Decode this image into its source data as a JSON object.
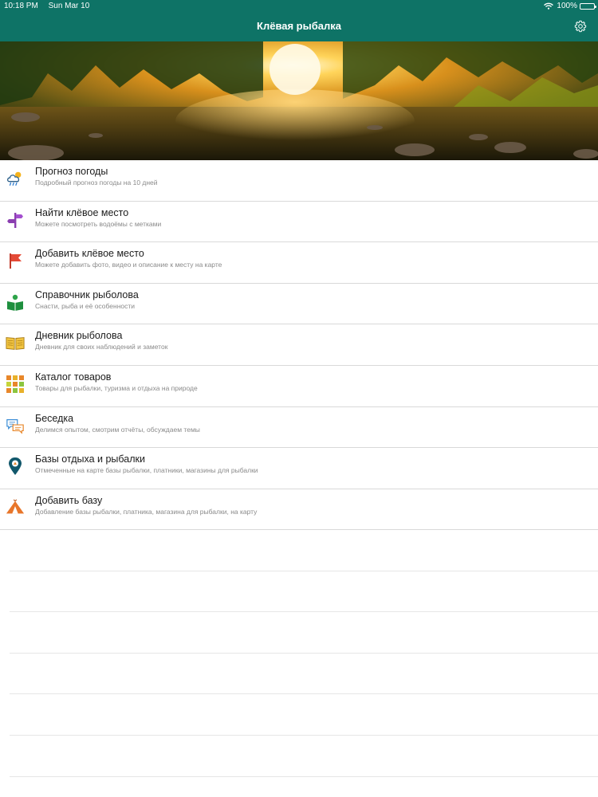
{
  "status": {
    "time": "10:18 PM",
    "date": "Sun Mar 10",
    "battery": "100%"
  },
  "header": {
    "title": "Клёвая рыбалка",
    "settings_icon": "gear-icon"
  },
  "menu": {
    "items": [
      {
        "label": "Прогноз погоды",
        "sub": "Подробный прогноз погоды на 10 дней",
        "icon": "weather-cloud-icon"
      },
      {
        "label": "Найти клёвое место",
        "sub": "Можете посмотреть водоёмы с метками",
        "icon": "signpost-icon"
      },
      {
        "label": "Добавить клёвое место",
        "sub": "Можете добавить фото, видео и описание к месту на карте",
        "icon": "flag-icon"
      },
      {
        "label": "Справочник рыболова",
        "sub": "Снасти, рыба и её особенности",
        "icon": "book-reader-icon"
      },
      {
        "label": "Дневник рыболова",
        "sub": "Дневник для своих наблюдений и заметок",
        "icon": "open-book-icon"
      },
      {
        "label": "Каталог товаров",
        "sub": "Товары для рыбалки, туризма и отдыха на природе",
        "icon": "grid-catalog-icon"
      },
      {
        "label": "Беседка",
        "sub": "Делимся опытом, смотрим отчёты, обсуждаем темы",
        "icon": "chat-bubbles-icon"
      },
      {
        "label": "Базы отдыха и рыбалки",
        "sub": "Отмеченные на карте базы рыбалки, платники, магазины для рыбалки",
        "icon": "map-pin-icon"
      },
      {
        "label": "Добавить базу",
        "sub": "Добавление базы рыбалки, платника, магазина для рыбалки, на карту",
        "icon": "tent-icon"
      }
    ]
  },
  "colors": {
    "accent": "#0e7366",
    "divider": "#d9d9d9",
    "subtitle": "#8a8a8a"
  }
}
